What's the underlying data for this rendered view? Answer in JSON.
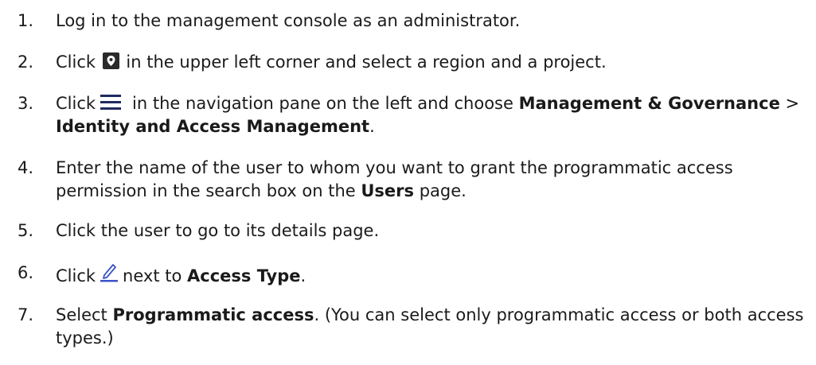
{
  "steps": [
    {
      "number": "1.",
      "text": "Log in to the management console as an administrator."
    },
    {
      "number": "2.",
      "before": "Click",
      "icon": "location-pin-icon",
      "after": "in the upper left corner and select a region and a project."
    },
    {
      "number": "3.",
      "before": "Click",
      "icon": "menu-icon",
      "mid": "in the navigation pane on the left and choose",
      "bold1": "Management & Governance",
      "sep": ">",
      "bold2": "Identity and Access Management",
      "end": "."
    },
    {
      "number": "4.",
      "text": "Enter the name of the user to whom you want to grant the programmatic access permission in the search box on the",
      "bold": "Users",
      "end": "page."
    },
    {
      "number": "5.",
      "text": "Click the user to go to its details page."
    },
    {
      "number": "6.",
      "before": "Click",
      "icon": "edit-pencil-icon",
      "mid": "next to",
      "bold": "Access Type",
      "end": "."
    },
    {
      "number": "7.",
      "before": "Select",
      "bold": "Programmatic access",
      "end": ". (You can select only programmatic access or both access types.)"
    }
  ],
  "colors": {
    "text": "#1a1a1a",
    "icon_dark": "#2a2a2a",
    "icon_accent": "#3b53c9"
  }
}
